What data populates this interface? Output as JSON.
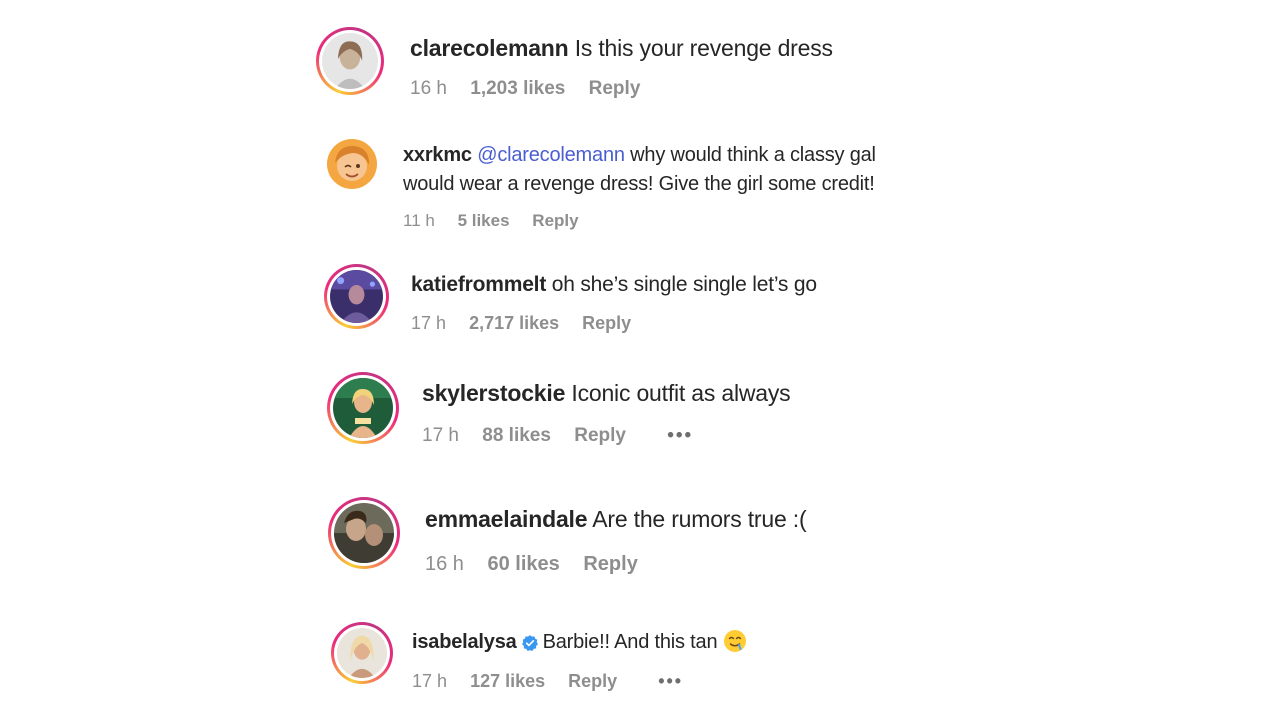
{
  "comments": [
    {
      "username": "clarecolemann",
      "text": "Is this your revenge dress",
      "time": "16 h",
      "likes": "1,203 likes",
      "reply": "Reply"
    },
    {
      "username": "xxrkmc",
      "mention": "@clarecolemann",
      "text_line1": "why would think a classy gal",
      "text_line2": "would wear a revenge dress! Give the girl some credit!",
      "time": "11 h",
      "likes": "5 likes",
      "reply": "Reply"
    },
    {
      "username": "katiefrommelt",
      "text": "oh she’s single single let’s go",
      "time": "17 h",
      "likes": "2,717 likes",
      "reply": "Reply"
    },
    {
      "username": "skylerstockie",
      "text": "Iconic outfit as always",
      "time": "17 h",
      "likes": "88 likes",
      "reply": "Reply",
      "more": "•••"
    },
    {
      "username": "emmaelaindale",
      "text": "Are the rumors true :(",
      "time": "16 h",
      "likes": "60 likes",
      "reply": "Reply"
    },
    {
      "username": "isabelalysa",
      "text": "Barbie!! And this tan",
      "time": "17 h",
      "likes": "127 likes",
      "reply": "Reply",
      "more": "•••"
    }
  ],
  "icons": {
    "verified": "verified-badge-icon",
    "emoji": "drooling-face-emoji",
    "more": "more-options-icon"
  },
  "colors": {
    "mention": "#4a5ed1",
    "meta": "#8e8e8e",
    "verified": "#3897f0"
  }
}
